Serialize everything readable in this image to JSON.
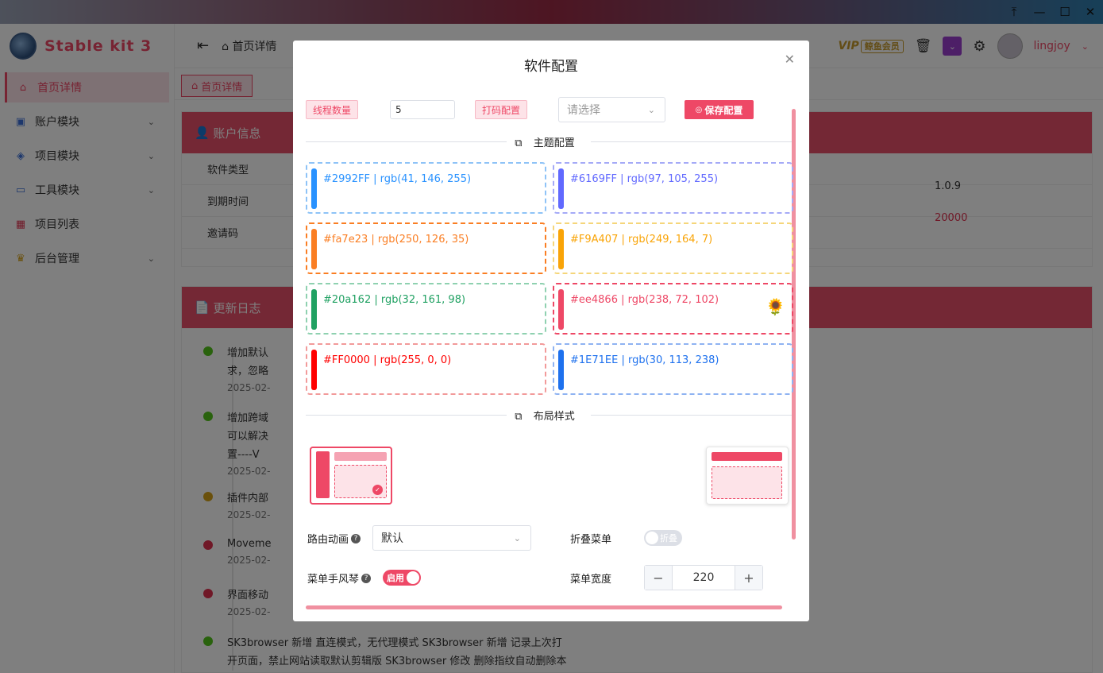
{
  "app": {
    "brand": "Stable kit 3",
    "breadcrumb": "首页详情",
    "vip_label": "VIP",
    "vip_badge": "鲸鱼会员",
    "username": "lingjoy",
    "tab": "首页详情"
  },
  "sidebar": {
    "items": [
      {
        "label": "首页详情",
        "icon": "home-icon"
      },
      {
        "label": "账户模块",
        "icon": "account-icon"
      },
      {
        "label": "项目模块",
        "icon": "layers-icon"
      },
      {
        "label": "工具模块",
        "icon": "briefcase-icon"
      },
      {
        "label": "项目列表",
        "icon": "grid-icon"
      },
      {
        "label": "后台管理",
        "icon": "crown-icon"
      }
    ]
  },
  "account_card": {
    "title": "账户信息",
    "rows": [
      "软件类型",
      "到期时间",
      "邀请码"
    ],
    "version": "1.0.9",
    "amount": "20000"
  },
  "changelog": {
    "title": "更新日志",
    "items": [
      {
        "text": "增加默认",
        "text2": "求，忽略",
        "date": "2025-02-",
        "color": "#52c41a"
      },
      {
        "text": "增加跨域",
        "text2": "可以解决",
        "text3": "置----V",
        "date": "2025-02-",
        "color": "#52c41a"
      },
      {
        "text": "插件内部",
        "date": "2025-02-",
        "color": "#d4a017"
      },
      {
        "text": "Moveme",
        "date": "2025-02-",
        "color": "#e0314f"
      },
      {
        "text": "界面移动",
        "date": "2025-02-",
        "color": "#e0314f"
      },
      {
        "text": "SK3browser 新增 直连模式，无代理模式 SK3browser 新增 记录上次打",
        "text2": "开页面，禁止网站读取默认剪辑版 SK3browser 修改 删除指纹自动删除本",
        "color": "#52c41a"
      }
    ]
  },
  "dialog": {
    "title": "软件配置",
    "thread_label": "线程数量",
    "thread_value": "5",
    "captcha_label": "打码配置",
    "captcha_placeholder": "请选择",
    "save_label": "保存配置",
    "theme_section": "主题配置",
    "layout_section": "布局样式",
    "themes": [
      {
        "label": "#2992FF | rgb(41, 146, 255)",
        "color": "#2992FF"
      },
      {
        "label": "#6169FF | rgb(97, 105, 255)",
        "color": "#6169FF"
      },
      {
        "label": "#fa7e23 | rgb(250, 126, 35)",
        "color": "#fa7e23"
      },
      {
        "label": "#F9A407 | rgb(249, 164, 7)",
        "color": "#F9A407"
      },
      {
        "label": "#20a162 | rgb(32, 161, 98)",
        "color": "#20a162"
      },
      {
        "label": "#ee4866 | rgb(238, 72, 102)",
        "color": "#ee4866",
        "selected": true
      },
      {
        "label": "#FF0000 | rgb(255, 0, 0)",
        "color": "#FF0000"
      },
      {
        "label": "#1E71EE | rgb(30, 113, 238)",
        "color": "#1E71EE"
      }
    ],
    "route_anim_label": "路由动画",
    "route_anim_value": "默认",
    "collapse_label": "折叠菜单",
    "collapse_switch": "折叠",
    "accordion_label": "菜单手风琴",
    "accordion_switch": "启用",
    "width_label": "菜单宽度",
    "width_value": "220"
  }
}
